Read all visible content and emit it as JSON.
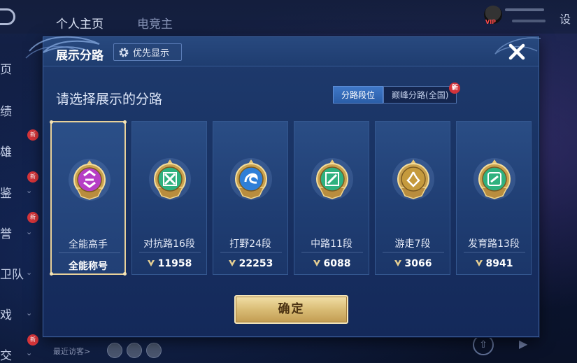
{
  "background": {
    "tabs": [
      "个人主页",
      "电竞主"
    ],
    "side_items": [
      "页",
      "绩",
      "雄",
      "鉴",
      "誉",
      "卫队",
      "戏",
      "交"
    ],
    "side_new_label": "新",
    "settings_label": "设",
    "vip_label": "VIP",
    "recent_visitors_label": "最近访客>"
  },
  "modal": {
    "title": "展示分路",
    "priority_button_label": "优先显示",
    "close_icon": "close-icon",
    "subtitle": "请选择展示的分路",
    "segments": [
      {
        "label": "分路段位",
        "active": true
      },
      {
        "label": "巅峰分路(全国)",
        "active": false,
        "badge": "新"
      }
    ],
    "cards": [
      {
        "rank_name": "全能高手",
        "score": "全能称号",
        "selected": true,
        "color": "#b63fc6",
        "show_score_icon": false
      },
      {
        "rank_name": "对抗路16段",
        "score": "11958",
        "selected": false,
        "color": "#2fb17f",
        "show_score_icon": true
      },
      {
        "rank_name": "打野24段",
        "score": "22253",
        "selected": false,
        "color": "#2f7fd8",
        "show_score_icon": true
      },
      {
        "rank_name": "中路11段",
        "score": "6088",
        "selected": false,
        "color": "#2fb17f",
        "show_score_icon": true
      },
      {
        "rank_name": "游走7段",
        "score": "3066",
        "selected": false,
        "color": "#c59a3d",
        "show_score_icon": true
      },
      {
        "rank_name": "发育路13段",
        "score": "8941",
        "selected": false,
        "color": "#2fb17f",
        "show_score_icon": true
      }
    ],
    "confirm_label": "确定"
  },
  "colors": {
    "accent_gold": "#e8d19a",
    "panel_blue": "#1f3b6e",
    "new_badge_red": "#d3333a"
  }
}
